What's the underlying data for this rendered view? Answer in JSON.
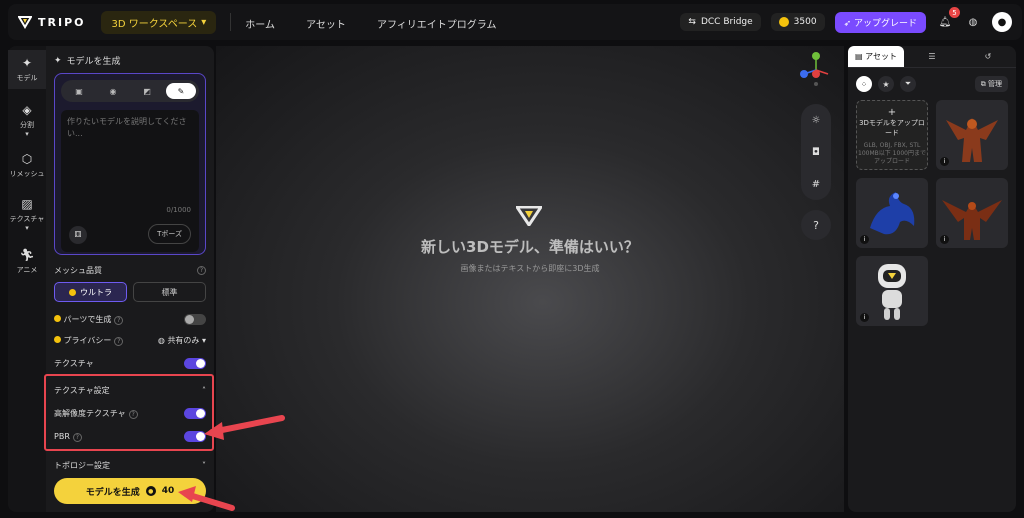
{
  "header": {
    "brand": "TRIPO",
    "workspace": "3D ワークスペース",
    "nav": [
      "ホーム",
      "アセット",
      "アフィリエイトプログラム"
    ],
    "dcc_bridge": "DCC Bridge",
    "credits": "3500",
    "upgrade": "アップグレード",
    "notification_count": "5"
  },
  "rail": {
    "items": [
      "モデル",
      "分割",
      "リメッシュ",
      "テクスチャ",
      "アニメ"
    ]
  },
  "panel": {
    "title": "モデルを生成",
    "prompt_placeholder": "作りたいモデルを説明してください...",
    "counter": "0/1000",
    "tpose": "Tポーズ",
    "mesh_quality_label": "メッシュ品質",
    "quality_ultra": "ウルトラ",
    "quality_standard": "標準",
    "parts_label": "パーツで生成",
    "privacy_label": "プライバシー",
    "privacy_value": "共有のみ",
    "texture_label": "テクスチャ",
    "texture_settings_label": "テクスチャ設定",
    "hires_texture_label": "高解像度テクスチャ",
    "pbr_label": "PBR",
    "topology_label": "トポロジー設定",
    "generate_label": "モデルを生成",
    "generate_cost": "40"
  },
  "viewport": {
    "title": "新しい3Dモデル、準備はいい？",
    "subtitle": "画像またはテキストから即座に3D生成"
  },
  "assets": {
    "tab_label": "アセット",
    "manage": "管理",
    "upload_title": "3Dモデルをアップロード",
    "upload_formats": "GLB, OBJ, FBX, STL 100MB以下 1000円までアップロード"
  }
}
